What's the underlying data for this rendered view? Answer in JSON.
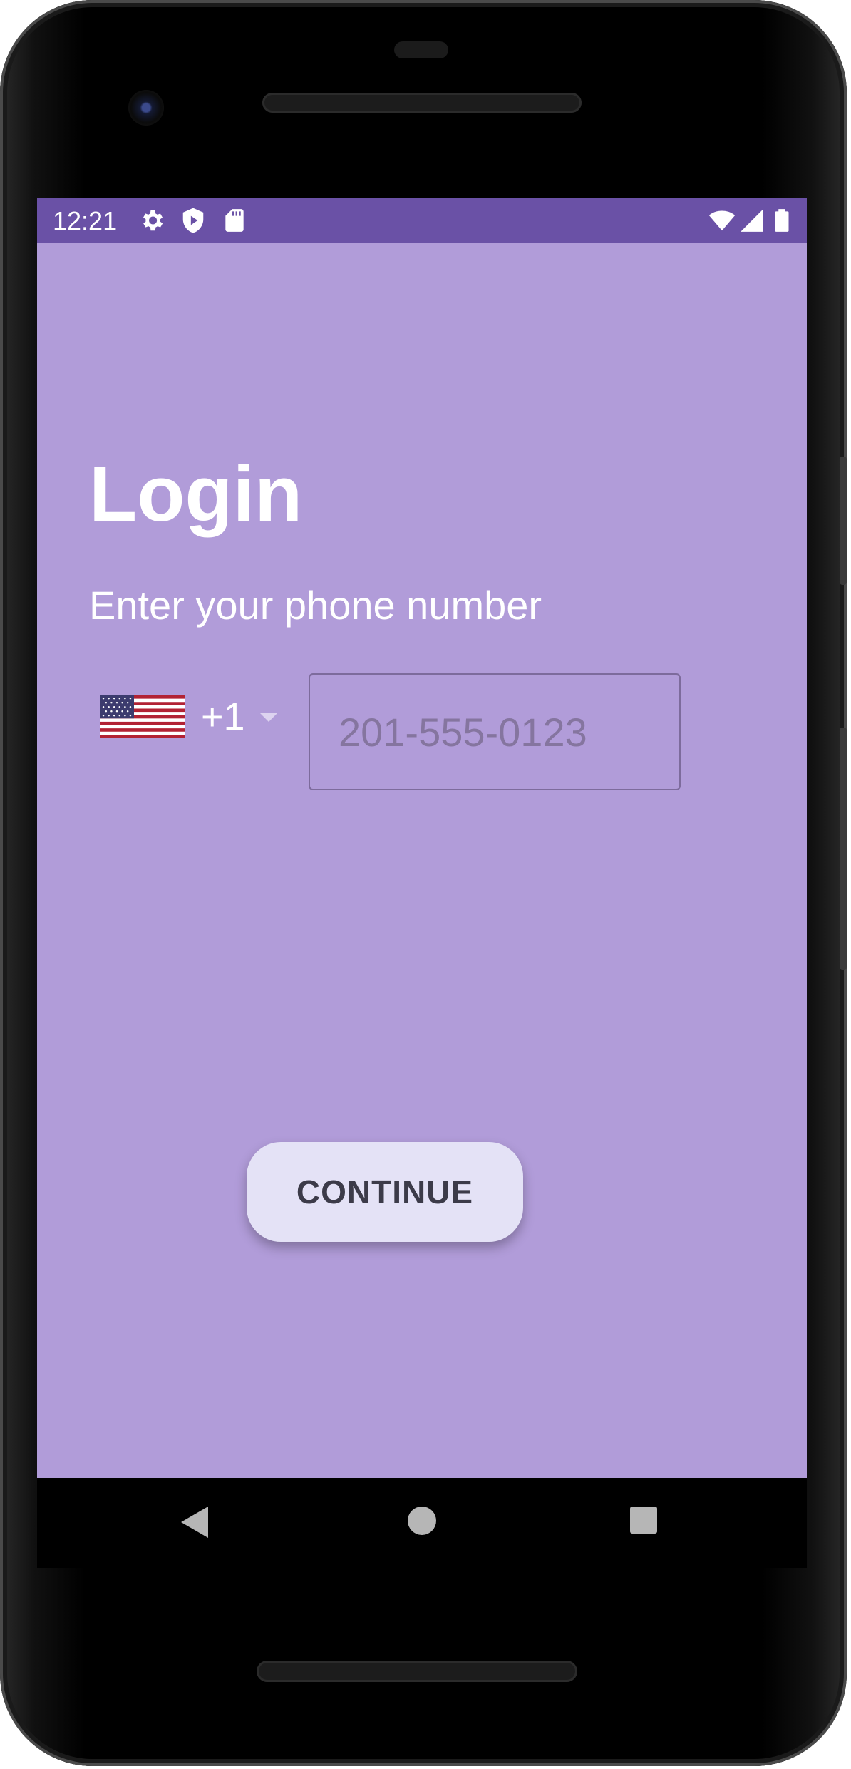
{
  "status_bar": {
    "time": "12:21",
    "left_icons": [
      "gear-icon",
      "shield-play-icon",
      "sd-card-icon"
    ],
    "right_icons": [
      "wifi-icon",
      "signal-icon",
      "battery-icon"
    ]
  },
  "login": {
    "title": "Login",
    "subtitle": "Enter your phone number",
    "country_code": "+1",
    "country_flag": "us-flag-icon",
    "phone_placeholder": "201-555-0123",
    "continue_label": "CONTINUE"
  },
  "navigation": {
    "buttons": [
      "back-icon",
      "home-icon",
      "recents-icon"
    ]
  },
  "colors": {
    "screen_background": "#b19cd9",
    "status_bar": "#6a51a6",
    "continue_button": "#e4e2f6"
  }
}
